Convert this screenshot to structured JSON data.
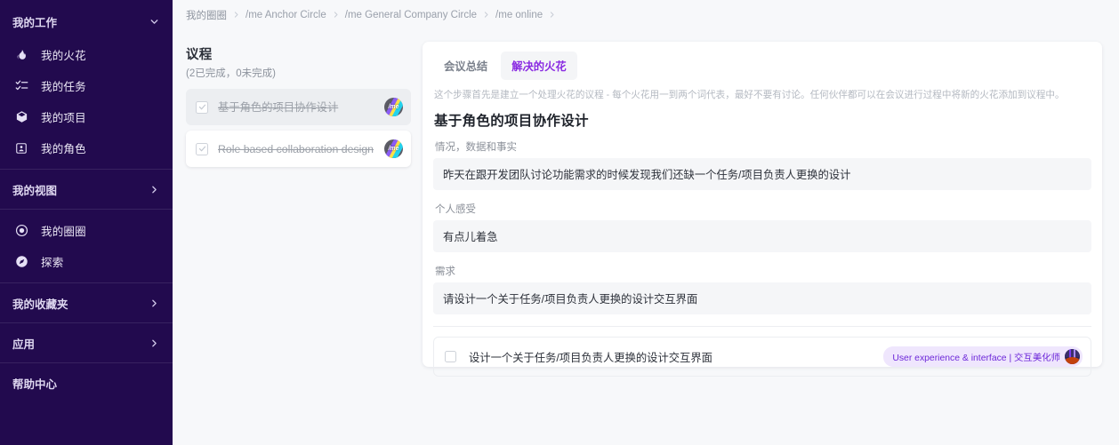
{
  "sidebar": {
    "sections": [
      {
        "type": "header",
        "label": "我的工作",
        "icon": "chevron-down-icon",
        "name": "sidebar-section-my-work"
      },
      {
        "type": "item",
        "label": "我的火花",
        "icon": "flame-icon",
        "name": "sidebar-item-my-sparks"
      },
      {
        "type": "item",
        "label": "我的任务",
        "icon": "task-list-icon",
        "name": "sidebar-item-my-tasks"
      },
      {
        "type": "item",
        "label": "我的项目",
        "icon": "box-icon",
        "name": "sidebar-item-my-projects"
      },
      {
        "type": "item",
        "label": "我的角色",
        "icon": "id-card-icon",
        "name": "sidebar-item-my-roles"
      },
      {
        "type": "divider"
      },
      {
        "type": "header",
        "label": "我的视图",
        "icon": "chevron-right-icon",
        "name": "sidebar-section-my-views"
      },
      {
        "type": "divider"
      },
      {
        "type": "item",
        "label": "我的圈圈",
        "icon": "circle-target-icon",
        "name": "sidebar-item-my-circles"
      },
      {
        "type": "item",
        "label": "探索",
        "icon": "compass-icon",
        "name": "sidebar-item-explore"
      },
      {
        "type": "divider"
      },
      {
        "type": "header",
        "label": "我的收藏夹",
        "icon": "chevron-right-icon",
        "name": "sidebar-section-favorites"
      },
      {
        "type": "divider"
      },
      {
        "type": "header",
        "label": "应用",
        "icon": "chevron-right-icon",
        "name": "sidebar-section-apps"
      },
      {
        "type": "divider"
      },
      {
        "type": "header",
        "label": "帮助中心",
        "icon": "none",
        "name": "sidebar-section-help-center"
      }
    ]
  },
  "breadcrumb": {
    "items": [
      "我的圈圈",
      "/me Anchor Circle",
      "/me General Company Circle",
      "/me online"
    ],
    "separator": "›"
  },
  "agenda": {
    "title": "议程",
    "subtitle": "(2已完成，0未完成)",
    "items": [
      {
        "text": "基于角色的项目协作设计",
        "checked": true,
        "selected": true,
        "avatar": "/me"
      },
      {
        "text": "Role based collaboration design",
        "checked": true,
        "selected": false,
        "avatar": "/me"
      }
    ]
  },
  "main": {
    "tabs": [
      {
        "label": "会议总结",
        "active": false
      },
      {
        "label": "解决的火花",
        "active": true
      }
    ],
    "description": "这个步骤首先是建立一个处理火花的议程 - 每个火花用一到两个词代表，最好不要有讨论。任何伙伴都可以在会议进行过程中将新的火花添加到议程中。",
    "title": "基于角色的项目协作设计",
    "fields": [
      {
        "label": "情况，数据和事实",
        "value": "昨天在跟开发团队讨论功能需求的时候发现我们还缺一个任务/项目负责人更换的设计"
      },
      {
        "label": "个人感受",
        "value": "有点儿着急"
      },
      {
        "label": "需求",
        "value": "请设计一个关于任务/项目负责人更换的设计交互界面"
      }
    ],
    "task": {
      "text": "设计一个关于任务/项目负责人更换的设计交互界面",
      "checked": false,
      "role_badge": "User experience & interface | 交互美化师"
    }
  },
  "colors": {
    "sidebar_bg": "#220a4e",
    "accent_purple": "#8a2be2",
    "badge_bg": "#efe6fd",
    "badge_text": "#6d28d9",
    "page_bg": "#f7f8fa",
    "field_bg": "#f5f6f8"
  }
}
